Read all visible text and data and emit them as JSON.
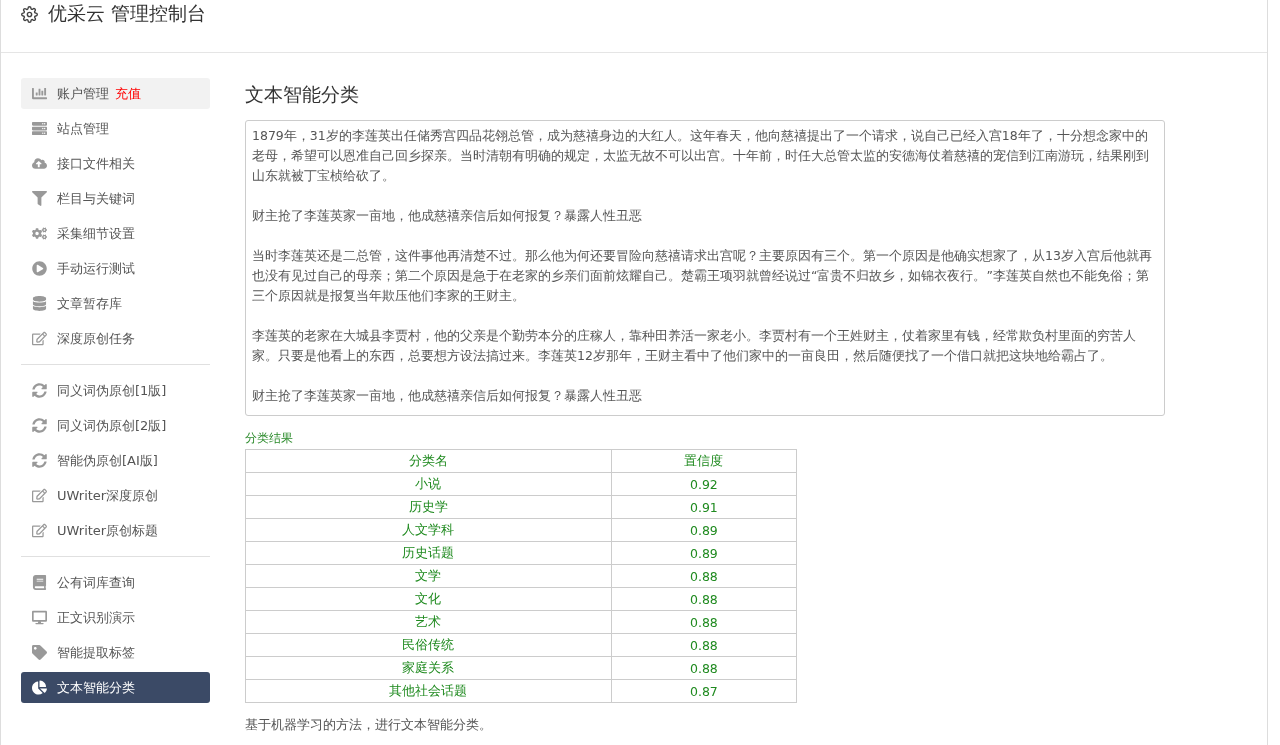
{
  "header": {
    "title": "优采云 管理控制台"
  },
  "sidebar": {
    "groups": [
      {
        "items": [
          {
            "label": "账户管理",
            "badge": "充值",
            "selected": false,
            "highlighted": true
          },
          {
            "label": "站点管理",
            "selected": false,
            "highlighted": false
          },
          {
            "label": "接口文件相关",
            "selected": false,
            "highlighted": false
          },
          {
            "label": "栏目与关键词",
            "selected": false,
            "highlighted": false
          },
          {
            "label": "采集细节设置",
            "selected": false,
            "highlighted": false
          },
          {
            "label": "手动运行测试",
            "selected": false,
            "highlighted": false
          },
          {
            "label": "文章暂存库",
            "selected": false,
            "highlighted": false
          },
          {
            "label": "深度原创任务",
            "selected": false,
            "highlighted": false
          }
        ]
      },
      {
        "items": [
          {
            "label": "同义词伪原创[1版]",
            "selected": false,
            "highlighted": false
          },
          {
            "label": "同义词伪原创[2版]",
            "selected": false,
            "highlighted": false
          },
          {
            "label": "智能伪原创[AI版]",
            "selected": false,
            "highlighted": false
          },
          {
            "label": "UWriter深度原创",
            "selected": false,
            "highlighted": false
          },
          {
            "label": "UWriter原创标题",
            "selected": false,
            "highlighted": false
          }
        ]
      },
      {
        "items": [
          {
            "label": "公有词库查询",
            "selected": false,
            "highlighted": false
          },
          {
            "label": "正文识别演示",
            "selected": false,
            "highlighted": false
          },
          {
            "label": "智能提取标签",
            "selected": false,
            "highlighted": false
          },
          {
            "label": "文本智能分类",
            "selected": true,
            "highlighted": false
          }
        ]
      }
    ]
  },
  "main": {
    "title": "文本智能分类",
    "text_input": {
      "value": [
        "1879年，31岁的李莲英出任储秀宫四品花翎总管，成为慈禧身边的大红人。这年春天，他向慈禧提出了一个请求，说自己已经入宫18年了，十分想念家中的老母，希望可以恩准自己回乡探亲。当时清朝有明确的规定，太监无故不可以出宫。十年前，时任大总管太监的安德海仗着慈禧的宠信到江南游玩，结果刚到山东就被丁宝桢给砍了。",
        "财主抢了李莲英家一亩地，他成慈禧亲信后如何报复？暴露人性丑恶",
        "当时李莲英还是二总管，这件事他再清楚不过。那么他为何还要冒险向慈禧请求出宫呢？主要原因有三个。第一个原因是他确实想家了，从13岁入宫后他就再也没有见过自己的母亲；第二个原因是急于在老家的乡亲们面前炫耀自己。楚霸王项羽就曾经说过“富贵不归故乡，如锦衣夜行。”李莲英自然也不能免俗；第三个原因就是报复当年欺压他们李家的王财主。",
        "李莲英的老家在大城县李贾村，他的父亲是个勤劳本分的庄稼人，靠种田养活一家老小。李贾村有一个王姓财主，仗着家里有钱，经常欺负村里面的穷苦人家。只要是他看上的东西，总要想方设法搞过来。李莲英12岁那年，王财主看中了他们家中的一亩良田，然后随便找了一个借口就把这块地给霸占了。",
        "财主抢了李莲英家一亩地，他成慈禧亲信后如何报复？暴露人性丑恶"
      ]
    },
    "result_label": "分类结果",
    "table": {
      "columns": [
        "分类名",
        "置信度"
      ],
      "rows": [
        [
          "小说",
          "0.92"
        ],
        [
          "历史学",
          "0.91"
        ],
        [
          "人文学科",
          "0.89"
        ],
        [
          "历史话题",
          "0.89"
        ],
        [
          "文学",
          "0.88"
        ],
        [
          "文化",
          "0.88"
        ],
        [
          "艺术",
          "0.88"
        ],
        [
          "民俗传统",
          "0.88"
        ],
        [
          "家庭关系",
          "0.88"
        ],
        [
          "其他社会话题",
          "0.87"
        ]
      ]
    },
    "footnote": "基于机器学习的方法，进行文本智能分类。"
  }
}
